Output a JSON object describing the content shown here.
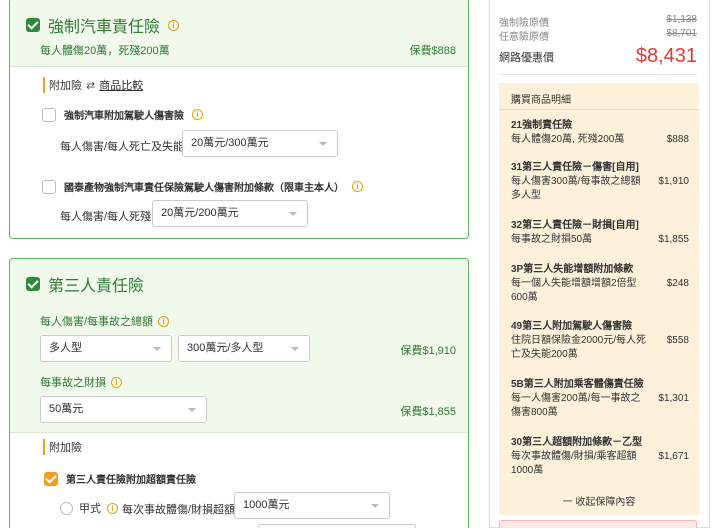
{
  "compulsory": {
    "title": "強制汽車責任險",
    "subtitle": "每人體傷20萬，死殘200萬",
    "price": "保費$888",
    "addon_label": "附加險",
    "compare_link": "商品比較",
    "addon1": {
      "title": "強制汽車附加駕駛人傷害險",
      "field_label": "每人傷害/每人死亡及失能",
      "select_value": "20萬元/300萬元"
    },
    "addon2": {
      "title": "國泰產物強制汽車責任保險駕駛人傷害附加條款（限車主本人）",
      "field_label": "每人傷害/每人死殘",
      "select_value": "20萬元/200萬元"
    }
  },
  "third_party": {
    "title": "第三人責任險",
    "bodily_label": "每人傷害/每事故之總額",
    "type_select": "多人型",
    "amount_select": "300萬元/多人型",
    "bodily_price": "保費$1,910",
    "property_label": "每事故之財損",
    "property_select": "50萬元",
    "property_price": "保費$1,855",
    "addon_label": "附加險",
    "excess": {
      "title": "第三人責任險附加超額責任險",
      "radio_label": "甲式",
      "field_label": "每次事故體傷/財損超額",
      "select_value": "1000萬元"
    }
  },
  "summary": {
    "compulsory_orig_label": "強制險原價",
    "compulsory_orig_value": "$1,138",
    "voluntary_orig_label": "任意險原價",
    "voluntary_orig_value": "$8,701",
    "online_label": "網路優惠價",
    "online_value": "$8,431",
    "detail_title": "購買商品明細",
    "items": [
      {
        "name": "21強制責任險",
        "desc": "每人體傷20萬, 死殘200萬",
        "amount": "$888"
      },
      {
        "name": "31第三人責任險－傷害[自用]",
        "desc": "每人傷害300萬/每事故之總額多人型",
        "amount": "$1,910"
      },
      {
        "name": "32第三人責任險－財損[自用]",
        "desc": "每事故之財損50萬",
        "amount": "$1,855"
      },
      {
        "name": "3P第三人失能增額附加條款",
        "desc": "每一個人失能增額增額2倍型600萬",
        "amount": "$248"
      },
      {
        "name": "49第三人附加駕駛人傷害險",
        "desc": "住院日額保險金2000元/每人死亡及失能200萬",
        "amount": "$558"
      },
      {
        "name": "5B第三人附加乘客體傷責任險",
        "desc": "每一人傷害200萬/每一事故之傷害800萬",
        "amount": "$1,301"
      },
      {
        "name": "30第三人超額附加條款－乙型",
        "desc": "每次事故體傷/財損/乘客超額1000萬",
        "amount": "$1,671"
      }
    ],
    "collapse_label": "一 收起保障內容"
  },
  "colors": {
    "green": "#2e7d32",
    "accent_orange": "#f0a020",
    "price_red": "#e53935",
    "detail_bg": "#fdf1dc"
  }
}
